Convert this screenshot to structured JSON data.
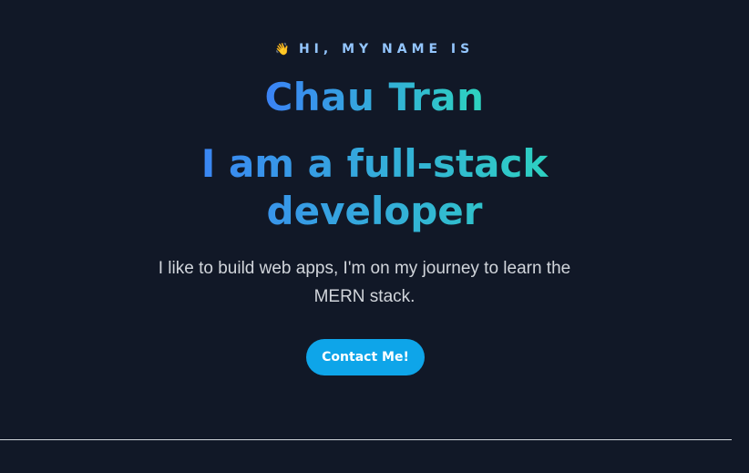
{
  "hero": {
    "greeting_icon": "waving-hand-icon",
    "greeting_icon_glyph": "👋",
    "greeting": "HI, MY NAME IS",
    "name": "Chau Tran",
    "role": "I am a full-stack developer",
    "tagline": "I like to build web apps, I'm on my journey to learn the MERN stack.",
    "cta_label": "Contact Me!"
  },
  "colors": {
    "background": "#111827",
    "gradient_start": "#3b82f6",
    "gradient_end": "#2dd4bf",
    "greeting_text": "#93c5fd",
    "tagline_text": "#d1d5db",
    "button_bg": "#0ea5e9",
    "button_text": "#ffffff",
    "divider": "#d1d5db"
  }
}
